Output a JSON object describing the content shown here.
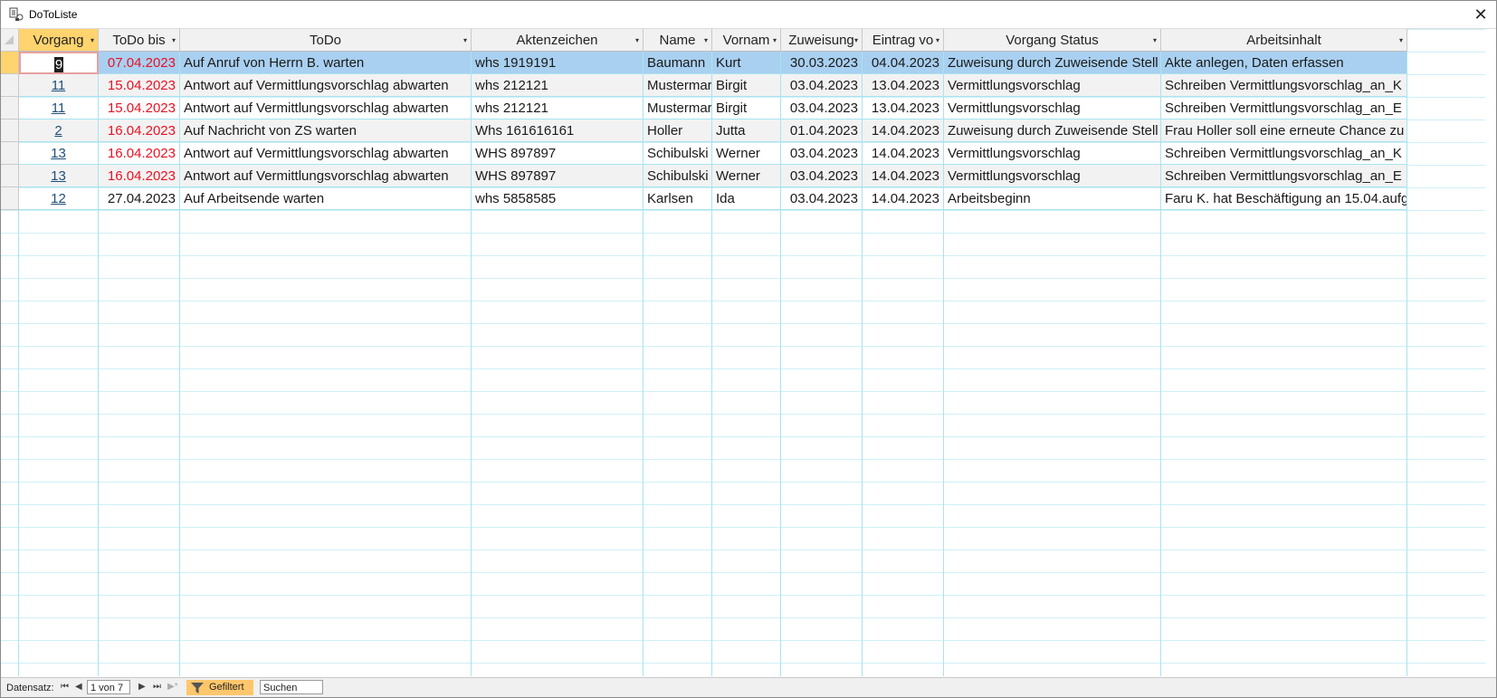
{
  "window": {
    "title": "DoToListe",
    "app_icon": "access-form-icon",
    "close_glyph": "✕"
  },
  "columns": [
    {
      "key": "vorgang",
      "label": "Vorgang",
      "arrow": "▾"
    },
    {
      "key": "todo_bis",
      "label": "ToDo bis",
      "arrow": "▾"
    },
    {
      "key": "todo",
      "label": "ToDo",
      "arrow": "▾"
    },
    {
      "key": "aktenzeichen",
      "label": "Aktenzeichen",
      "arrow": "▾"
    },
    {
      "key": "name",
      "label": "Name",
      "arrow": "▾"
    },
    {
      "key": "vorname",
      "label": "Vornam",
      "arrow": "▾"
    },
    {
      "key": "zuweisung",
      "label": "Zuweisung",
      "arrow": "▾"
    },
    {
      "key": "eintrag",
      "label": "Eintrag vo",
      "arrow": "▾"
    },
    {
      "key": "status",
      "label": "Vorgang Status",
      "arrow": "▾"
    },
    {
      "key": "inhalt",
      "label": "Arbeitsinhalt",
      "arrow": "▾"
    }
  ],
  "rows": [
    {
      "vorgang": "9",
      "todo_bis": "07.04.2023",
      "todo": "Auf Anruf von Herrn B. warten",
      "aktenzeichen": "whs 1919191",
      "name": "Baumann",
      "vorname": "Kurt",
      "zuweisung": "30.03.2023",
      "eintrag": "04.04.2023",
      "status": "Zuweisung durch Zuweisende Stell",
      "inhalt": "Akte anlegen, Daten erfassen"
    },
    {
      "vorgang": "11",
      "todo_bis": "15.04.2023",
      "todo": "Antwort auf Vermittlungsvorschlag abwarten",
      "aktenzeichen": "whs 212121",
      "name": "Mustermar",
      "vorname": "Birgit",
      "zuweisung": "03.04.2023",
      "eintrag": "13.04.2023",
      "status": "Vermittlungsvorschlag",
      "inhalt": "Schreiben Vermittlungsvorschlag_an_K"
    },
    {
      "vorgang": "11",
      "todo_bis": "15.04.2023",
      "todo": "Antwort auf Vermittlungsvorschlag abwarten",
      "aktenzeichen": "whs 212121",
      "name": "Mustermar",
      "vorname": "Birgit",
      "zuweisung": "03.04.2023",
      "eintrag": "13.04.2023",
      "status": "Vermittlungsvorschlag",
      "inhalt": "Schreiben Vermittlungsvorschlag_an_E"
    },
    {
      "vorgang": "2",
      "todo_bis": "16.04.2023",
      "todo": "Auf Nachricht von ZS warten",
      "aktenzeichen": "Whs 161616161",
      "name": "Holler",
      "vorname": "Jutta",
      "zuweisung": "01.04.2023",
      "eintrag": "14.04.2023",
      "status": "Zuweisung durch Zuweisende Stell",
      "inhalt": "Frau Holler soll eine erneute Chance zu"
    },
    {
      "vorgang": "13",
      "todo_bis": "16.04.2023",
      "todo": "Antwort auf Vermittlungsvorschlag abwarten",
      "aktenzeichen": "WHS 897897",
      "name": "Schibulski",
      "vorname": "Werner",
      "zuweisung": "03.04.2023",
      "eintrag": "14.04.2023",
      "status": "Vermittlungsvorschlag",
      "inhalt": "Schreiben Vermittlungsvorschlag_an_K"
    },
    {
      "vorgang": "13",
      "todo_bis": "16.04.2023",
      "todo": "Antwort auf Vermittlungsvorschlag abwarten",
      "aktenzeichen": "WHS 897897",
      "name": "Schibulski",
      "vorname": "Werner",
      "zuweisung": "03.04.2023",
      "eintrag": "14.04.2023",
      "status": "Vermittlungsvorschlag",
      "inhalt": "Schreiben Vermittlungsvorschlag_an_E"
    },
    {
      "vorgang": "12",
      "todo_bis": "27.04.2023",
      "todo": "Auf  Arbeitsende warten",
      "aktenzeichen": "whs 5858585",
      "name": "Karlsen",
      "vorname": "Ida",
      "zuweisung": "03.04.2023",
      "eintrag": "14.04.2023",
      "status": "Arbeitsbeginn",
      "inhalt": "Faru K. hat Beschäftigung an 15.04.aufg"
    }
  ],
  "statusbar": {
    "record_label": "Datensatz:",
    "first_glyph": "⏮",
    "prev_glyph": "◀",
    "record_value": "1 von 7",
    "next_glyph": "▶",
    "last_glyph": "⏭",
    "new_glyph": "▶*",
    "filter_label": "Gefiltert",
    "search_placeholder": "Suchen"
  },
  "colors": {
    "selected_row": "#a9d0f0",
    "overdue_date": "#e81123",
    "active_header": "#ffd46e",
    "filter_badge": "#ffc66b"
  }
}
